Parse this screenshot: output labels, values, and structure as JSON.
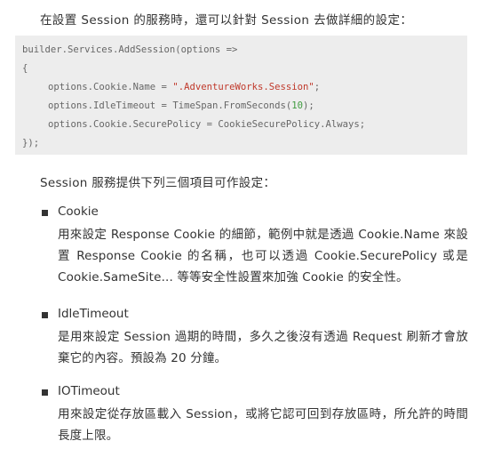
{
  "intro": "在設置 Session 的服務時，還可以針對 Session 去做詳細的設定：",
  "code": {
    "line1": "builder.Services.AddSession(options =>",
    "line2": "{",
    "line3_pre": "options.Cookie.Name = ",
    "line3_str": "\".AdventureWorks.Session\"",
    "line3_post": ";",
    "line4_pre": "options.IdleTimeout = TimeSpan.FromSeconds(",
    "line4_num": "10",
    "line4_post": ");",
    "line5": "options.Cookie.SecurePolicy = CookieSecurePolicy.Always;",
    "line6": "});"
  },
  "lead": "Session 服務提供下列三個項目可作設定：",
  "items": [
    {
      "title": "Cookie",
      "body": "用來設定 Response Cookie 的細節，範例中就是透過 Cookie.Name 來設置 Response Cookie 的名稱，也可以透過 Cookie.SecurePolicy 或是 Cookie.SameSite... 等等安全性設置來加強 Cookie 的安全性。"
    },
    {
      "title": "IdleTimeout",
      "body": "是用來設定 Session 過期的時間，多久之後沒有透過 Request 刷新才會放棄它的內容。預設為 20 分鐘。"
    },
    {
      "title": "IOTimeout",
      "body": "用來設定從存放區載入 Session，或將它認可回到存放區時，所允許的時間長度上限。"
    }
  ]
}
